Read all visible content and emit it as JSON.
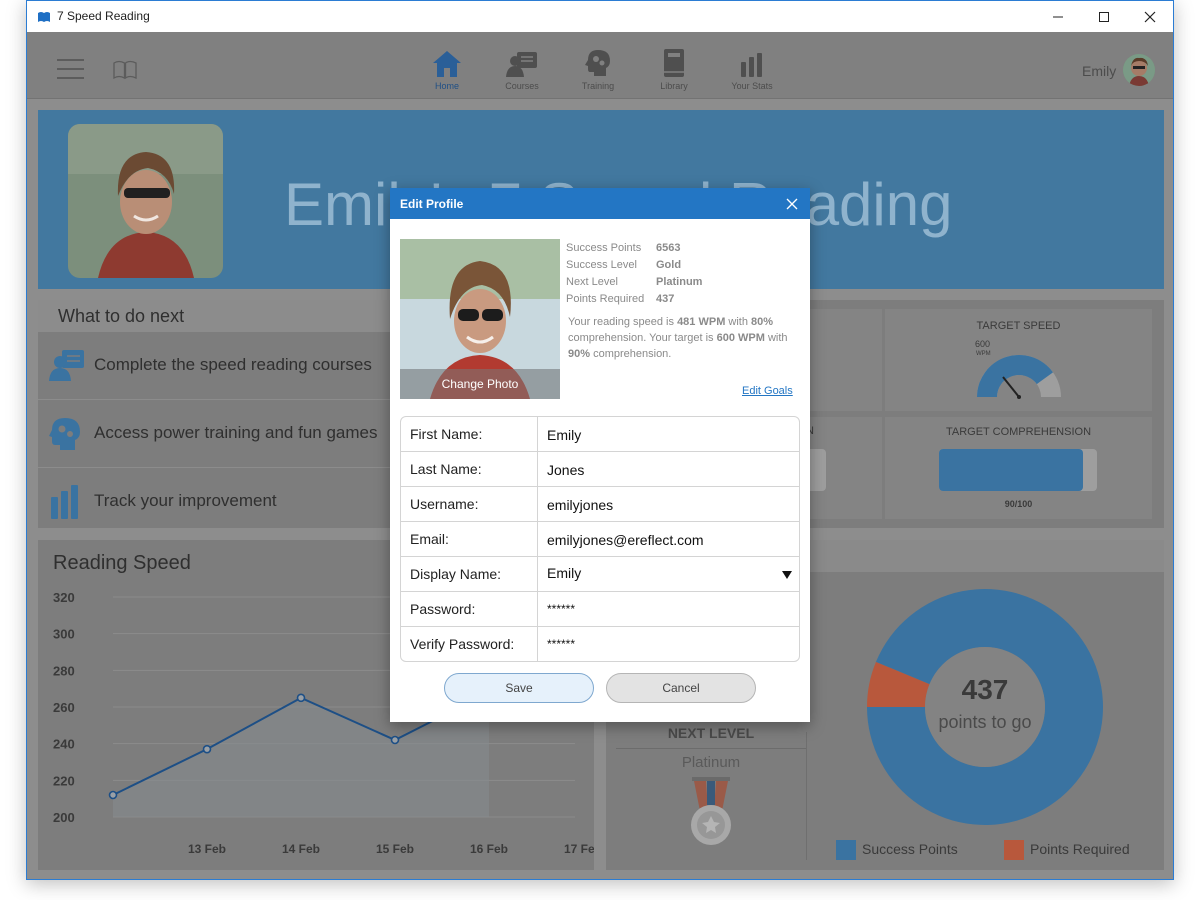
{
  "window": {
    "title": "7 Speed Reading"
  },
  "nav": {
    "items": [
      {
        "label": "Home",
        "icon": "home-icon"
      },
      {
        "label": "Courses",
        "icon": "courses-icon"
      },
      {
        "label": "Training",
        "icon": "training-icon"
      },
      {
        "label": "Library",
        "icon": "library-icon"
      },
      {
        "label": "Your Stats",
        "icon": "stats-icon"
      }
    ],
    "user_name": "Emily"
  },
  "banner": {
    "title": "Emily's 7 Speed Reading"
  },
  "todo": {
    "title": "What to do next",
    "items": [
      {
        "label": "Complete the speed reading courses"
      },
      {
        "label": "Access power training and fun games"
      },
      {
        "label": "Track your improvement"
      }
    ]
  },
  "stats": {
    "target_speed_label": "TARGET SPEED",
    "target_speed_value": "600",
    "target_speed_unit": "WPM",
    "target_speed_fraction": 0.8,
    "target_comp_label": "TARGET COMPREHENSION",
    "target_comp_value": "90/100",
    "partial_label": "N"
  },
  "speed_chart": {
    "title": "Reading Speed"
  },
  "chart_data": {
    "type": "line",
    "title": "Reading Speed",
    "xlabel": "",
    "ylabel": "",
    "x": [
      "13 Feb",
      "14 Feb",
      "15 Feb",
      "16 Feb",
      "17 Feb"
    ],
    "y_ticks": [
      "320",
      "300",
      "280",
      "260",
      "240",
      "220",
      "200"
    ],
    "ylim": [
      200,
      320
    ],
    "points": [
      {
        "x": "12 Feb",
        "y": 212
      },
      {
        "x": "13 Feb",
        "y": 237
      },
      {
        "x": "14 Feb",
        "y": 265
      },
      {
        "x": "15 Feb",
        "y": 242
      },
      {
        "x": "16 Feb",
        "y": 268
      }
    ]
  },
  "levels": {
    "next_level_title": "NEXT LEVEL",
    "next_level_name": "Platinum",
    "donut_value": "437",
    "donut_caption": "points to go",
    "legend": [
      {
        "label": "Success Points",
        "color": "#3a73a1"
      },
      {
        "label": "Points Required",
        "color": "#b8583c"
      }
    ],
    "success_points": 6563,
    "points_required": 437
  },
  "dialog": {
    "title": "Edit Profile",
    "change_photo": "Change Photo",
    "info": [
      {
        "label": "Success Points",
        "value": "6563"
      },
      {
        "label": "Success Level",
        "value": "Gold"
      },
      {
        "label": "Next Level",
        "value": "Platinum"
      },
      {
        "label": "Points Required",
        "value": "437"
      }
    ],
    "msg": {
      "p1": "Your reading speed is ",
      "speed": "481 WPM",
      "p2": " with ",
      "comp": "80%",
      "p3": " comprehension. Your target is ",
      "target_speed": "600 WPM",
      "p4": " with ",
      "target_comp": "90%",
      "p5": " comprehension."
    },
    "edit_goals": "Edit Goals",
    "fields": [
      {
        "label": "First Name:",
        "value": "Emily"
      },
      {
        "label": "Last Name:",
        "value": "Jones"
      },
      {
        "label": "Username:",
        "value": "emilyjones"
      },
      {
        "label": "Email:",
        "value": "emilyjones@ereflect.com"
      },
      {
        "label": "Display Name:",
        "value": "Emily"
      },
      {
        "label": "Password:",
        "value": "******"
      },
      {
        "label": "Verify Password:",
        "value": "******"
      }
    ],
    "save": "Save",
    "cancel": "Cancel"
  },
  "colors": {
    "accent": "#2376c4",
    "banner": "#42789f",
    "chart_line": "#1d4f86"
  }
}
